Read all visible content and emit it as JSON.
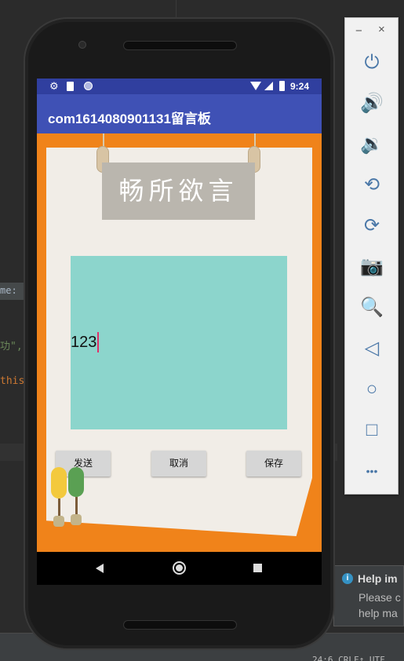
{
  "ide": {
    "name_label": "me:",
    "code_line1": "功\",?",
    "code_line2": "this",
    "status_text": "24:6  CRLF↕  UTF",
    "help": {
      "title": "Help im",
      "line1": "Please c",
      "line2": "help ma"
    }
  },
  "statusbar": {
    "time": "9:24",
    "icons": [
      "gear-icon",
      "sd-card-icon",
      "circle-notification-icon",
      "wifi-icon",
      "signal-icon",
      "battery-icon"
    ]
  },
  "appbar": {
    "title": "com1614080901131留言板"
  },
  "board": {
    "sign_text": "畅所欲言",
    "message_value": "123",
    "buttons": {
      "send": "发送",
      "cancel": "取消",
      "save": "保存"
    }
  },
  "navbar": {
    "icons": [
      "back-icon",
      "home-icon",
      "recents-icon"
    ]
  },
  "emulator_toolbar": {
    "minimize": "−",
    "close": "×",
    "buttons": [
      {
        "name": "power-icon",
        "glyph": "⏻"
      },
      {
        "name": "volume-up-icon",
        "glyph": "🔊"
      },
      {
        "name": "volume-down-icon",
        "glyph": "🔉"
      },
      {
        "name": "rotate-left-icon",
        "glyph": "⟲"
      },
      {
        "name": "rotate-right-icon",
        "glyph": "⟳"
      },
      {
        "name": "camera-icon",
        "glyph": "📷"
      },
      {
        "name": "zoom-icon",
        "glyph": "🔍"
      },
      {
        "name": "back-icon",
        "glyph": "◁"
      },
      {
        "name": "home-icon",
        "glyph": "○"
      },
      {
        "name": "overview-icon",
        "glyph": "□"
      },
      {
        "name": "more-icon",
        "glyph": "•••"
      }
    ]
  },
  "colors": {
    "appbar": "#3f51b5",
    "statusbar": "#303f9f",
    "background": "#f0831a",
    "paper": "#f1ede7",
    "textarea": "#8cd5cc",
    "button": "#d6d6d6"
  }
}
